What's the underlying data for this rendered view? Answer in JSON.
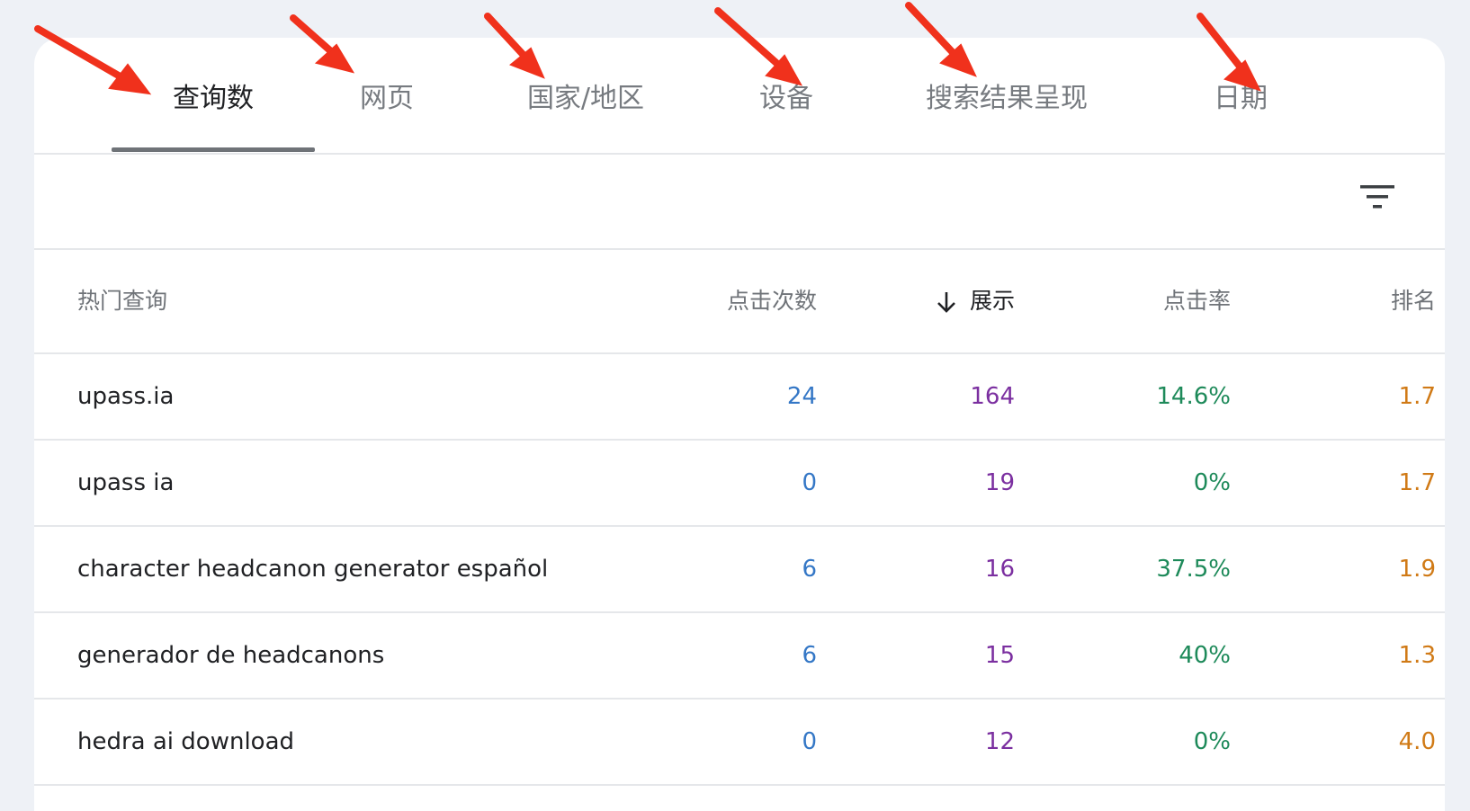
{
  "tabs": [
    {
      "label": "查询数",
      "active": true
    },
    {
      "label": "网页",
      "active": false
    },
    {
      "label": "国家/地区",
      "active": false
    },
    {
      "label": "设备",
      "active": false
    },
    {
      "label": "搜索结果呈现",
      "active": false
    },
    {
      "label": "日期",
      "active": false
    }
  ],
  "toolbar": {
    "filter_icon": "filter-list-icon"
  },
  "table": {
    "headers": {
      "query": "热门查询",
      "clicks": "点击次数",
      "impressions": "展示",
      "ctr": "点击率",
      "position": "排名"
    },
    "sort": {
      "column": "impressions",
      "direction": "descending"
    },
    "rows": [
      {
        "query": "upass.ia",
        "clicks": "24",
        "impressions": "164",
        "ctr": "14.6%",
        "position": "1.7"
      },
      {
        "query": "upass ia",
        "clicks": "0",
        "impressions": "19",
        "ctr": "0%",
        "position": "1.7"
      },
      {
        "query": "character headcanon generator español",
        "clicks": "6",
        "impressions": "16",
        "ctr": "37.5%",
        "position": "1.9"
      },
      {
        "query": "generador de headcanons",
        "clicks": "6",
        "impressions": "15",
        "ctr": "40%",
        "position": "1.3"
      },
      {
        "query": "hedra ai download",
        "clicks": "0",
        "impressions": "12",
        "ctr": "0%",
        "position": "4.0"
      }
    ]
  },
  "colors": {
    "clicks": "#3477c6",
    "impressions": "#7b2fa0",
    "ctr": "#1e8a5a",
    "position": "#d07a16",
    "annotation_arrow": "#f0311c"
  }
}
